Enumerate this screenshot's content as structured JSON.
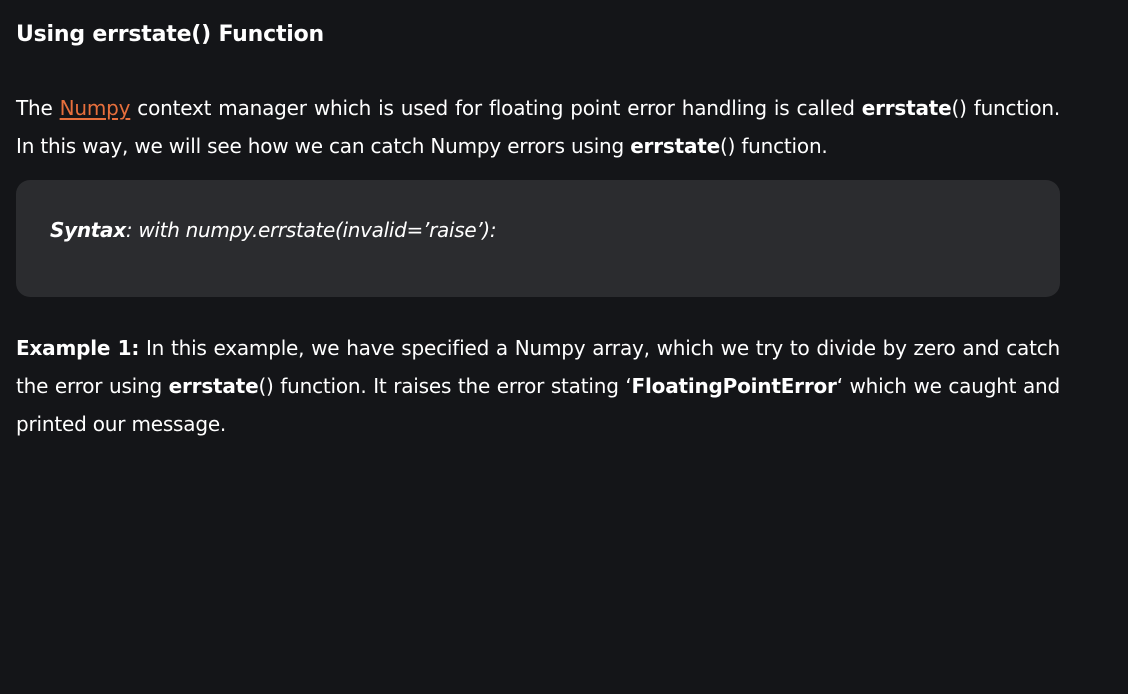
{
  "section": {
    "title": "Using errstate() Function"
  },
  "intro": {
    "p1": "The ",
    "link": "Numpy",
    "p2": " context manager which is used for floating point error handling is called ",
    "b1": "errstate",
    "p3": "() function. In this way, we will see how we can catch Numpy errors using ",
    "b2": "errstate",
    "p4": "() function."
  },
  "syntax": {
    "label": "Syntax",
    "text": ": with numpy.errstate(invalid=’raise’):"
  },
  "example": {
    "label": "Example 1:",
    "p1": " In this example, we have specified a Numpy array, which we try to divide by zero and catch the error using ",
    "b1": "errstate",
    "p2": "() function. It raises the error stating ‘",
    "b2": "FloatingPointError",
    "p3": "‘ which we caught and printed our message."
  }
}
